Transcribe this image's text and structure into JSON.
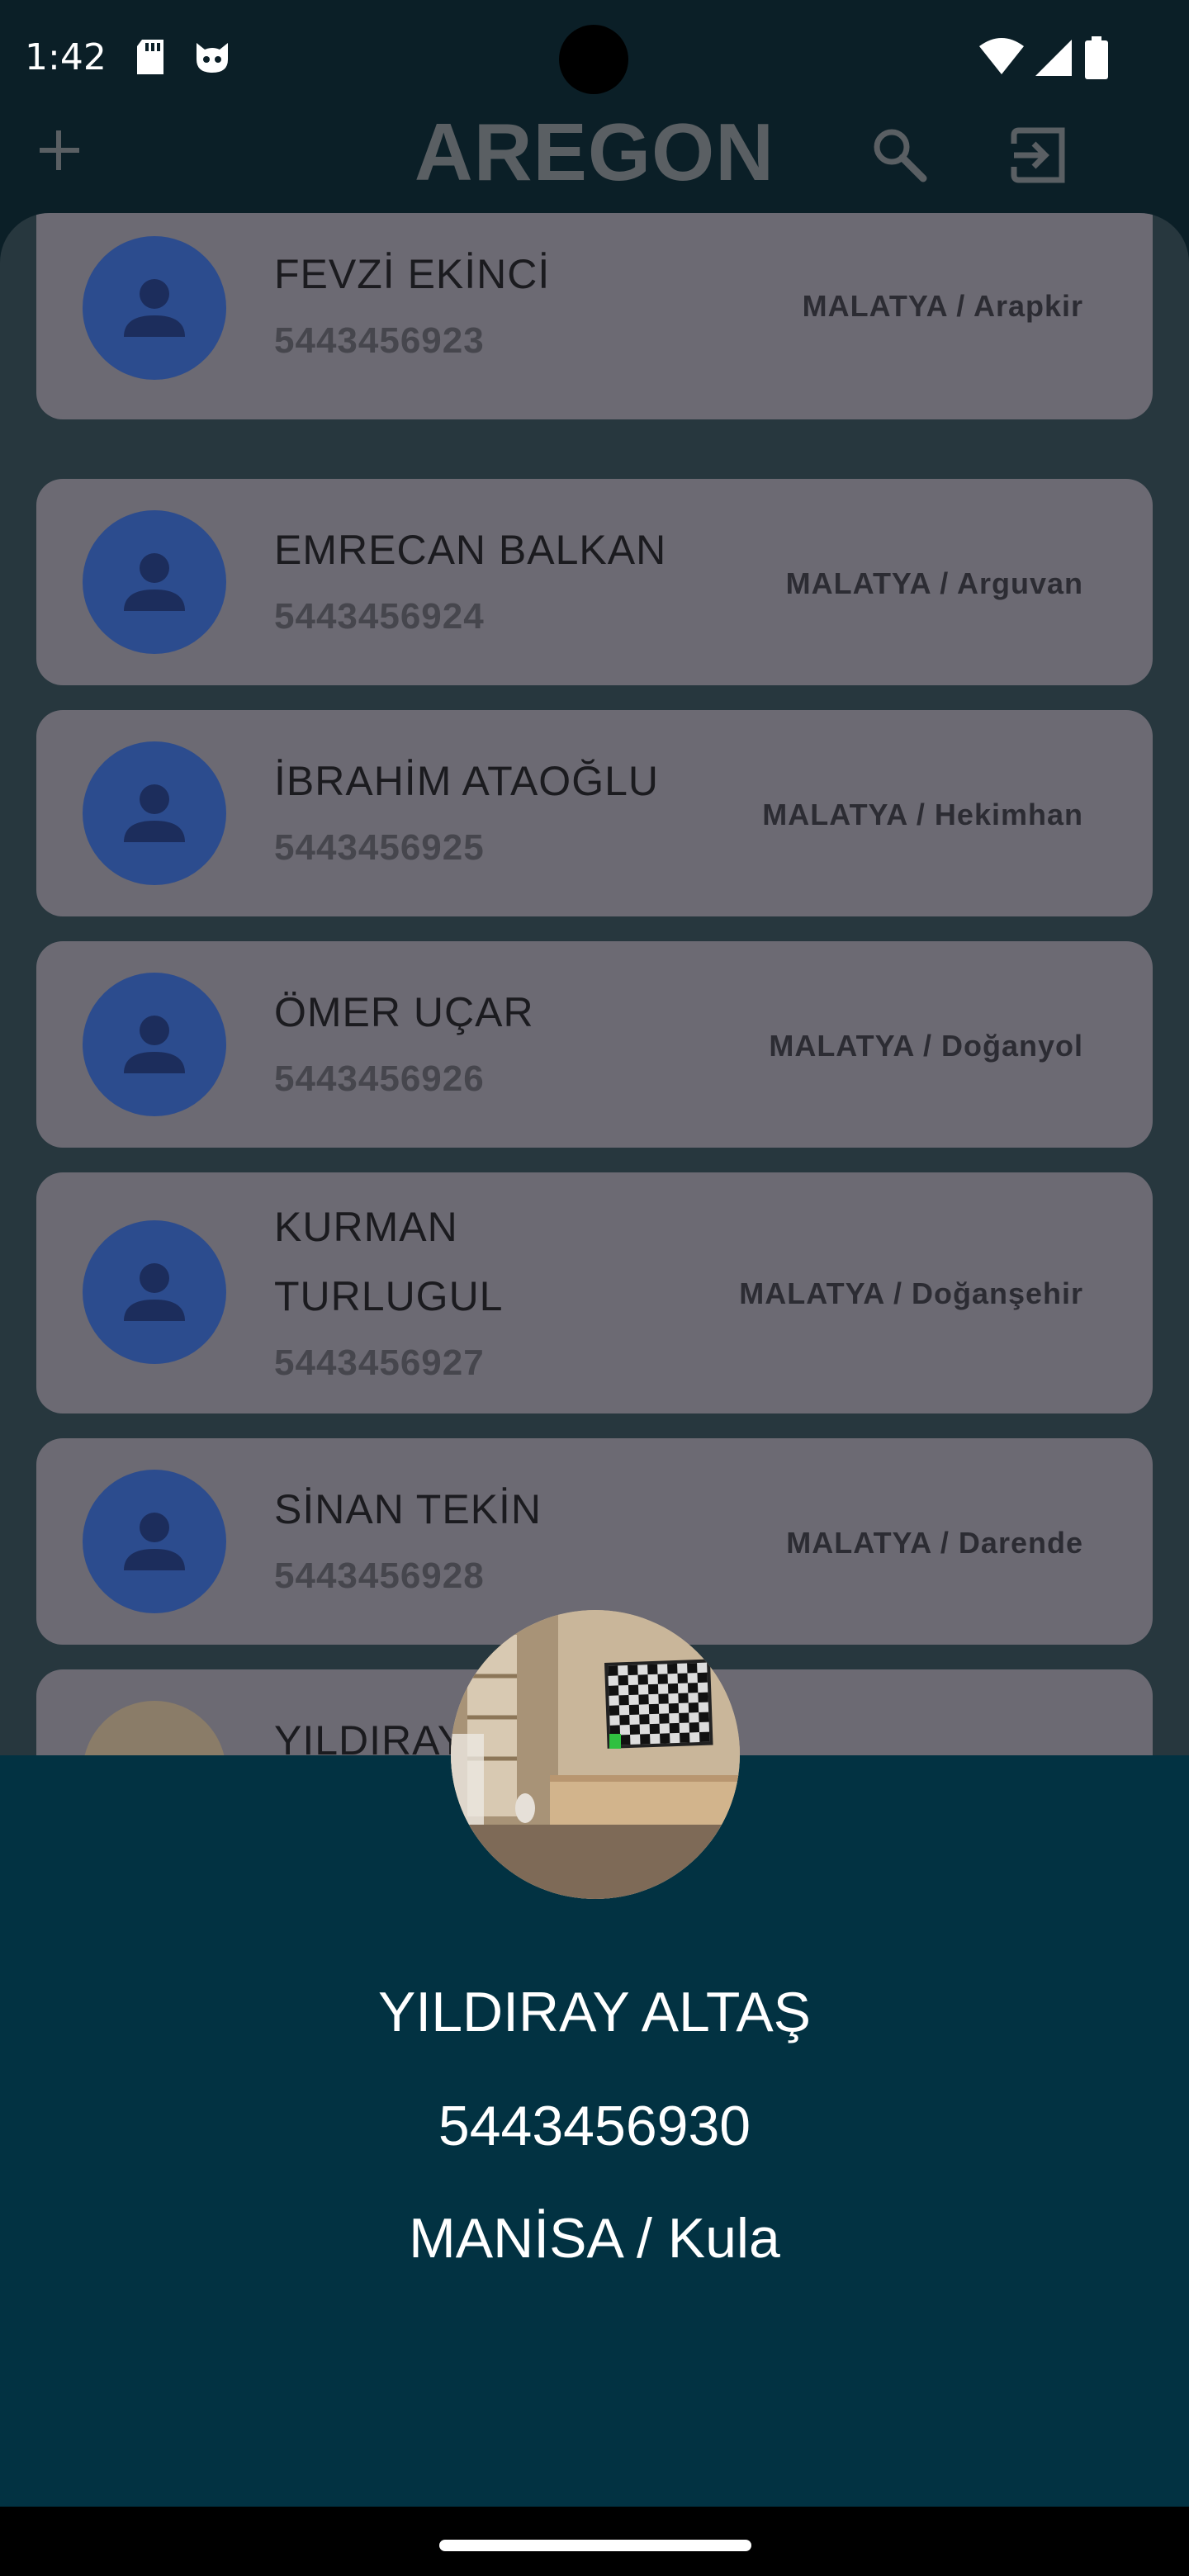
{
  "status_bar": {
    "time": "1:42",
    "icons": [
      "sd-card-icon",
      "cat-face-icon",
      "wifi-icon",
      "signal-icon",
      "battery-icon"
    ]
  },
  "app_bar": {
    "title": "AREGON",
    "add_icon": "plus-icon",
    "search_icon": "search-icon",
    "logout_icon": "logout-icon"
  },
  "contacts": [
    {
      "name": "FEVZİ EKİNCİ",
      "phone": "5443456923",
      "location": "MALATYA / Arapkir"
    },
    {
      "name": "EMRECAN BALKAN",
      "phone": "5443456924",
      "location": "MALATYA / Arguvan"
    },
    {
      "name": "İBRAHİM ATAOĞLU",
      "phone": "5443456925",
      "location": "MALATYA / Hekimhan"
    },
    {
      "name": "ÖMER UÇAR",
      "phone": "5443456926",
      "location": "MALATYA / Doğanyol"
    },
    {
      "name": "KURMAN TURLUGUL",
      "phone": "5443456927",
      "location": "MALATYA / Doğanşehir"
    },
    {
      "name": "SİNAN TEKİN",
      "phone": "5443456928",
      "location": "MALATYA / Darende"
    },
    {
      "name": "YILDIRAY",
      "phone": "",
      "location": ""
    }
  ],
  "detail_sheet": {
    "name": "YILDIRAY ALTAŞ",
    "phone": "5443456930",
    "location": "MANİSA / Kula"
  },
  "colors": {
    "background": "#0b1f27",
    "list_background": "#27373e",
    "card": "#6c6a73",
    "avatar": "#2c4c8e",
    "sheet": "#023242"
  }
}
